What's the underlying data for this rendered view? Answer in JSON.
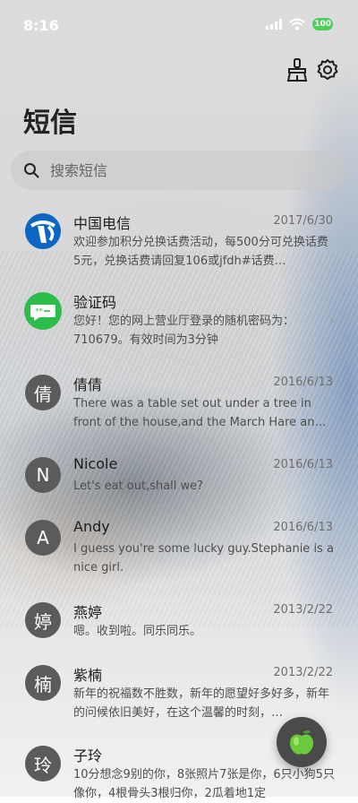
{
  "status_bar": {
    "time": "8:16",
    "battery": "100",
    "battery_color": "#4ad05a"
  },
  "header": {
    "title": "短信",
    "icons": [
      "broom-icon",
      "gear-icon"
    ]
  },
  "search": {
    "placeholder": "搜索短信"
  },
  "messages": [
    {
      "name": "中国电信",
      "date": "2017/6/30",
      "snippet": "欢迎参加积分兑换话费活动，每500分可兑换话费5元，兑换话费请回复106或jfdh#话费…",
      "avatar": "china-telecom-logo-icon"
    },
    {
      "name": "验证码",
      "date": "",
      "snippet": "您好！您的网上营业厅登录的随机密码为：710679。有效时间为3分钟",
      "avatar": "verification-code-icon",
      "has_chevron": true
    },
    {
      "name": "倩倩",
      "date": "2016/6/13",
      "snippet": "There was a table set out under a tree in front of the house,and the March Hare an…",
      "avatar_text": "倩"
    },
    {
      "name": "Nicole",
      "date": "2016/6/13",
      "snippet": "Let's eat out,shall we?",
      "avatar_text": "N"
    },
    {
      "name": "Andy",
      "date": "2016/6/13",
      "snippet": "I guess you're some lucky guy.Stephanie is a nice girl.",
      "avatar_text": "A"
    },
    {
      "name": "燕婷",
      "date": "2013/2/22",
      "snippet": "嗯。收到啦。同乐同乐。",
      "avatar_text": "婷"
    },
    {
      "name": "紫楠",
      "date": "2013/2/22",
      "snippet": "新年的祝福数不胜数，新年的愿望好多好多，新年的问候依旧美好，在这个温馨的时刻，…",
      "avatar_text": "楠"
    },
    {
      "name": "子玲",
      "date": "",
      "snippet": "10分想念9别的你，8张照片7张是你，6只小狗5只像你，4根骨头3根归你，2瓜着地1定",
      "avatar_text": "玲"
    }
  ],
  "fab": {
    "icon": "green-apple-icon"
  }
}
